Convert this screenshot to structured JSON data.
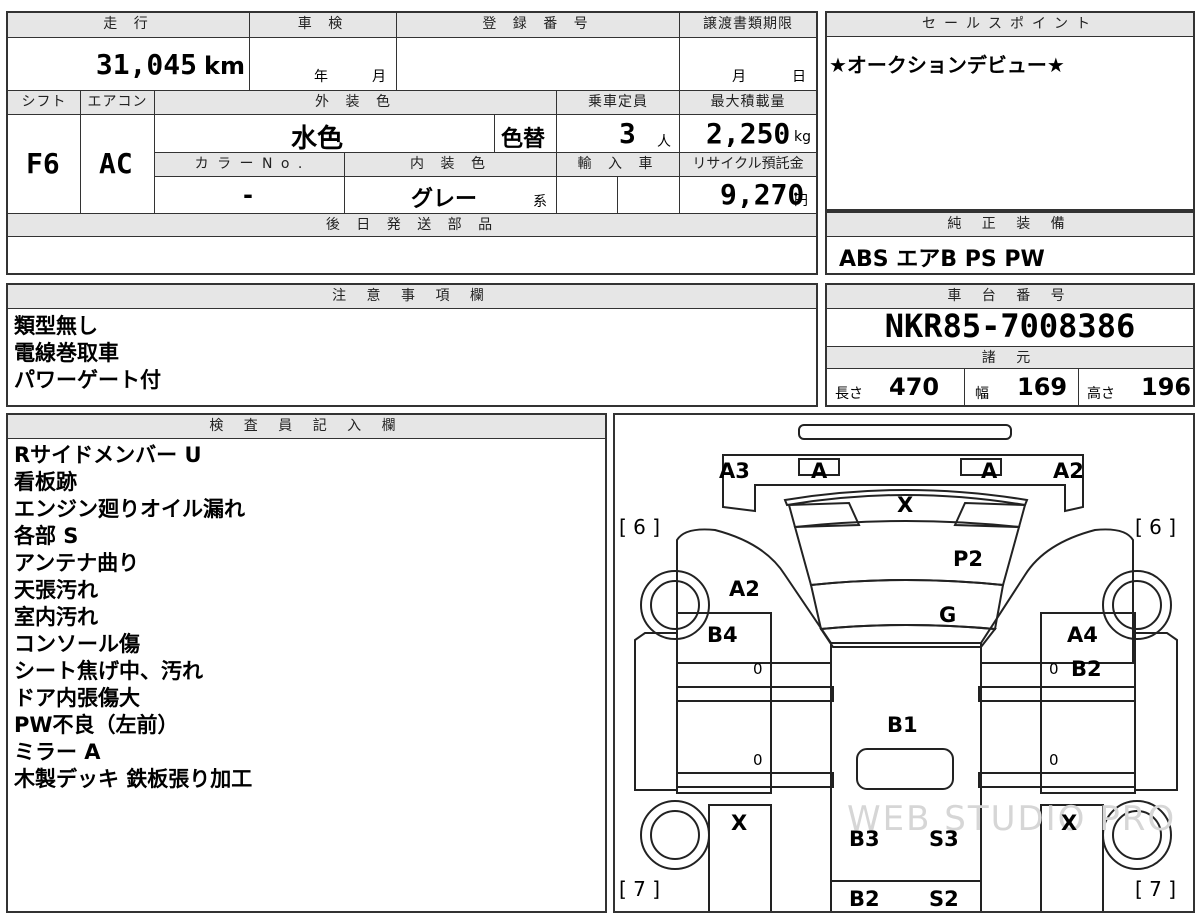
{
  "specs": {
    "mileage_header": "走 行",
    "mileage_value": "31,045",
    "mileage_unit": "km",
    "inspection_header": "車 検",
    "inspection_year_unit": "年",
    "inspection_month_unit": "月",
    "registration_header": "登 録 番 号",
    "transfer_header": "譲渡書類期限",
    "transfer_month_unit": "月",
    "transfer_day_unit": "日",
    "shift_header": "シフト",
    "shift_value": "F6",
    "ac_header": "エアコン",
    "ac_value": "AC",
    "exterior_header": "外 装 色",
    "exterior_value": "水色",
    "color_change": "色替",
    "capacity_header": "乗車定員",
    "capacity_value": "3",
    "capacity_unit": "人",
    "maxload_header": "最大積載量",
    "maxload_value": "2,250",
    "maxload_unit": "kg",
    "colorno_header": "カ ラ ー N o .",
    "colorno_value": "-",
    "interior_header": "内 装 色",
    "interior_value": "グレー",
    "interior_unit": "系",
    "import_header": "輸 入 車",
    "recycle_header": "リサイクル預託金",
    "recycle_value": "9,270",
    "recycle_unit": "円",
    "later_parts_header": "後 日 発 送 部 品"
  },
  "sales_point": {
    "header": "セールスポイント",
    "text": "★オークションデビュー★"
  },
  "equipment": {
    "header": "純 正 装 備",
    "text": "ABS エアB PS PW"
  },
  "notes": {
    "header": "注 意 事 項 欄",
    "lines": [
      "類型無し",
      "電線巻取車",
      "パワーゲート付"
    ]
  },
  "chassis": {
    "header": "車 台 番 号",
    "number": "NKR85-7008386",
    "dims_header": "諸 元",
    "length_label": "長さ",
    "length_value": "470",
    "width_label": "幅",
    "width_value": "169",
    "height_label": "高さ",
    "height_value": "196"
  },
  "inspector": {
    "header": "検 査 員 記 入 欄",
    "lines": [
      "Rサイドメンバー U",
      "看板跡",
      "エンジン廻りオイル漏れ",
      "各部 S",
      "アンテナ曲り",
      "天張汚れ",
      "室内汚れ",
      "コンソール傷",
      "シート焦げ中、汚れ",
      "ドア内張傷大",
      "PW不良（左前）",
      "ミラー A",
      "木製デッキ 鉄板張り加工"
    ]
  },
  "diagram": {
    "marks": [
      "A3",
      "A",
      "A",
      "A2",
      "X",
      "P2",
      "A2",
      "G",
      "B4",
      "A4",
      "B2",
      "B1",
      "X",
      "X",
      "B3",
      "S3",
      "B2",
      "S2"
    ],
    "brackets": [
      "[ 6 ]",
      "[ 6 ]",
      "[ 7 ]",
      "[ 7 ]"
    ],
    "zeros": [
      "0",
      "0",
      "0",
      "0"
    ],
    "watermark": "WEB STUDIO PRO"
  }
}
